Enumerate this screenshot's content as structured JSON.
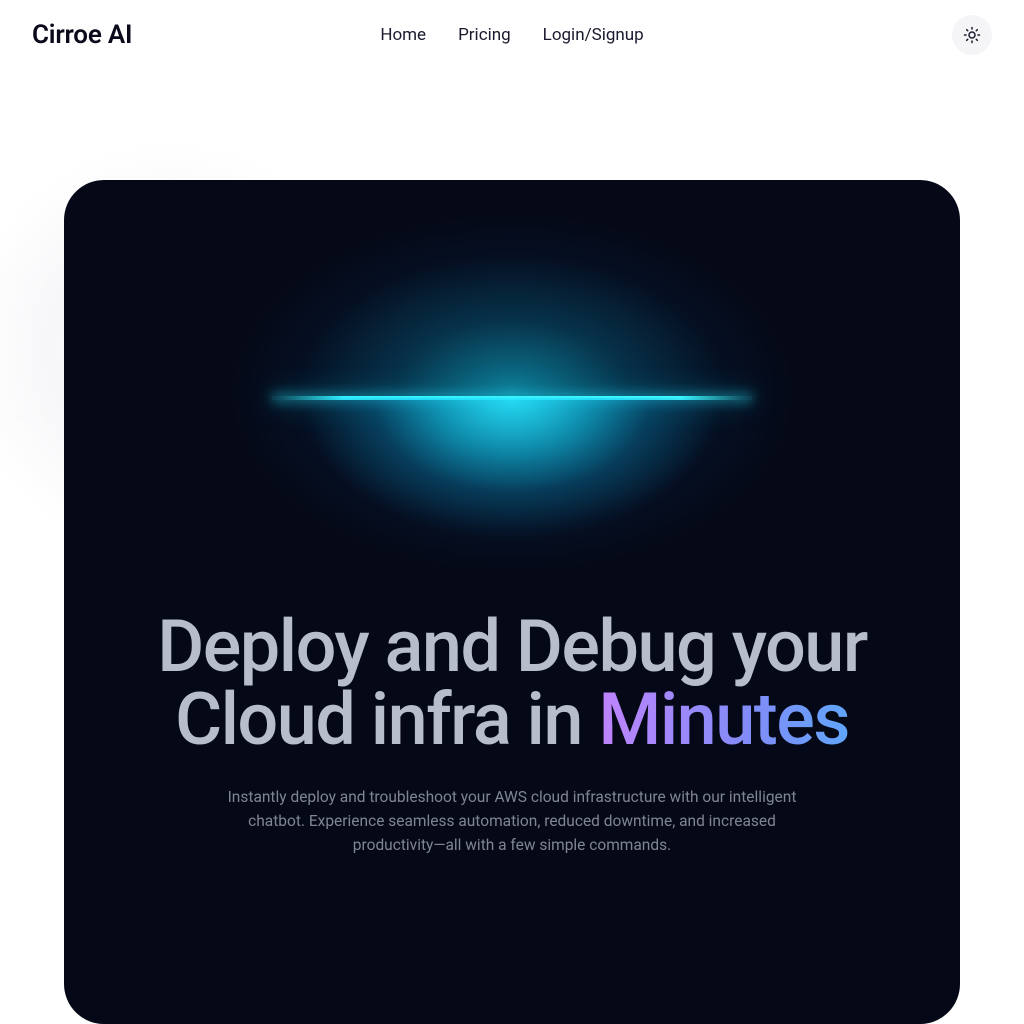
{
  "brand": "Cirroe AI",
  "nav": {
    "home": "Home",
    "pricing": "Pricing",
    "login": "Login/Signup"
  },
  "hero": {
    "headline_prefix": "Deploy and Debug your Cloud infra in ",
    "headline_highlight": "Minutes",
    "subtext": "Instantly deploy and troubleshoot your AWS cloud infrastructure with our intelligent chatbot. Experience seamless automation, reduced downtime, and increased productivity—all with a few simple commands."
  },
  "icons": {
    "theme_toggle": "sun-icon"
  },
  "colors": {
    "hero_bg": "#050816",
    "glow": "#22d8ff",
    "gradient_start": "#c084fc",
    "gradient_end": "#60a5fa"
  }
}
